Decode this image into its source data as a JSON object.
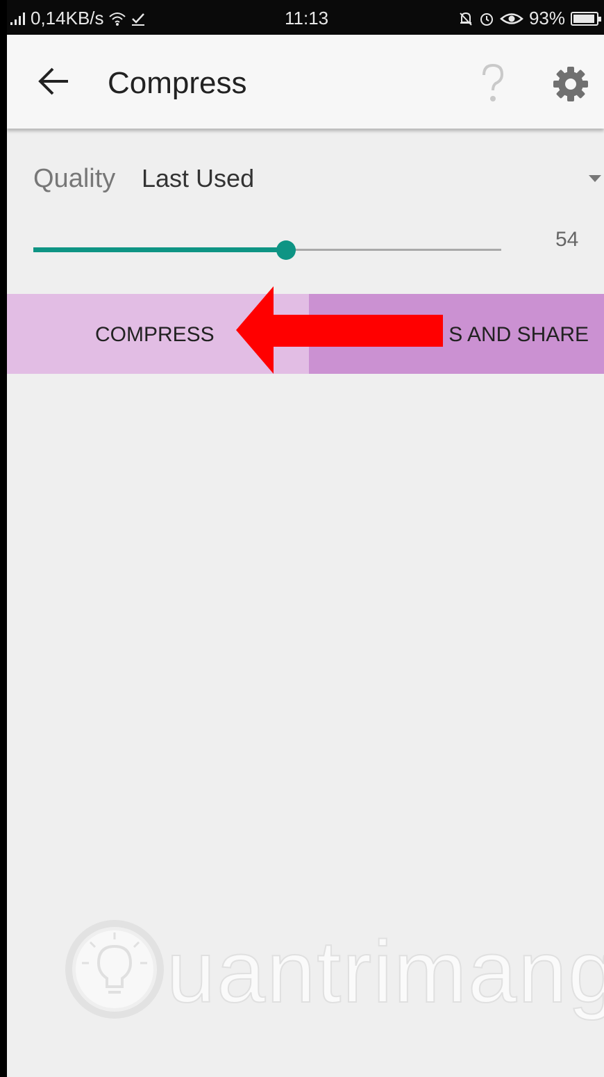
{
  "status_bar": {
    "network_speed": "0,14KB/s",
    "time": "11:13",
    "battery_percent": "93%",
    "battery_level": 0.93
  },
  "app_bar": {
    "title": "Compress",
    "icons": [
      "back-arrow-icon",
      "help-icon",
      "gear-icon"
    ]
  },
  "quality": {
    "label": "Quality",
    "value": "Last Used",
    "slider_value": "54",
    "slider_min": 0,
    "slider_max": 100
  },
  "actions": {
    "compress_label": "COMPRESS",
    "share_label": "S AND SHARE"
  },
  "annotation": {
    "arrow_color": "#ff0000"
  },
  "watermark": {
    "text": "uantrimang"
  },
  "colors": {
    "accent": "#0e9484",
    "compress_bg": "#e2bde4",
    "share_bg": "#cb91d2"
  }
}
